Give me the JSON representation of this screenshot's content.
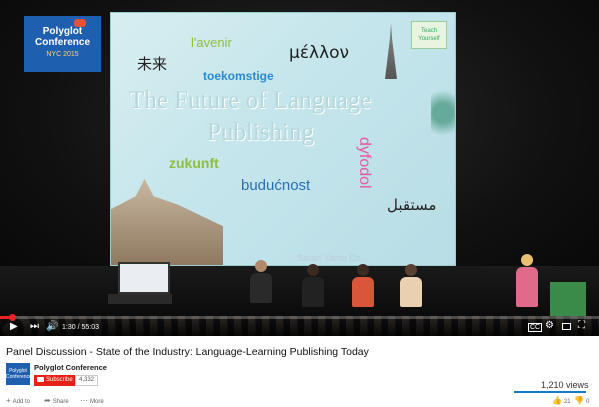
{
  "video": {
    "logo": {
      "line1": "Polyglot",
      "line2": "Conference",
      "line3": "NYC 2015"
    },
    "slide": {
      "words": {
        "avenir": "l'avenir",
        "mellon": "μέλλον",
        "weilai": "未来",
        "toekomstige": "toekomstige",
        "zukunft": "zukunft",
        "buducnost": "budućnost",
        "dyfodol": "dyfodol",
        "arabic": "مستقبل"
      },
      "title_line1": "The Future of Language",
      "title_line2": "Publishing",
      "badge": "Teach Yourself",
      "presenter": "Sarah Yarno Co..."
    },
    "progress": 0.02,
    "time": "1:30 / 55:03",
    "icons": {
      "play": "play-icon",
      "next": "next-icon",
      "volume": "volume-icon",
      "settings": "gear-icon",
      "theater": "theater-icon",
      "fullscreen": "fullscreen-icon"
    },
    "cc": "CC"
  },
  "info": {
    "title": "Panel Discussion - State of the Industry: Language-Learning Publishing Today",
    "channel": "Polyglot Conference",
    "avatar_text": "Polyglot Conference",
    "subscribe": "Subscribe",
    "subscriber_count": "4,332",
    "views": "1,210 views",
    "like_ratio": 1.0,
    "actions": {
      "add": "Add to",
      "share": "Share",
      "more": "More"
    },
    "likes": "21",
    "dislikes": "0"
  },
  "colors": {
    "accent": "#e62117",
    "brand": "#1f5fb0",
    "like": "#167ac6"
  }
}
